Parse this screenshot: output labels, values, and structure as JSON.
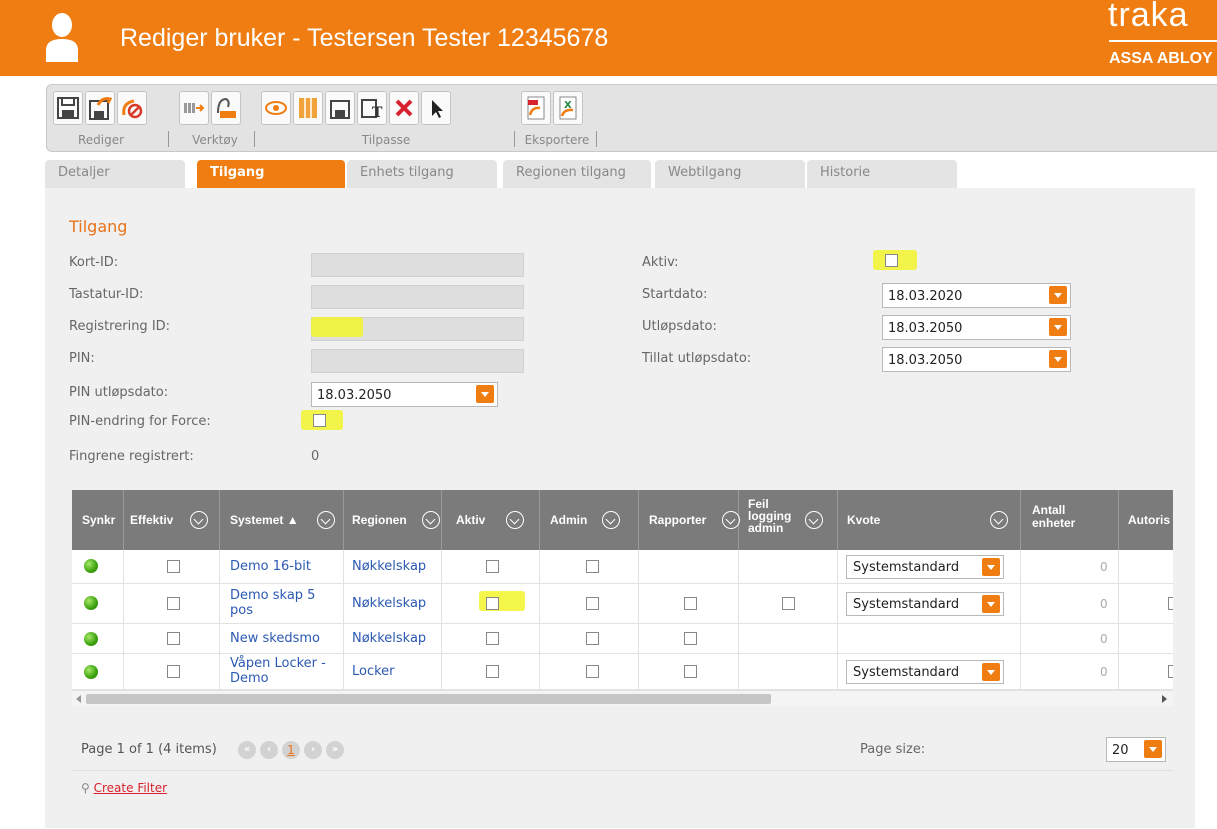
{
  "header": {
    "title": "Rediger bruker - Testersen Tester 12345678",
    "brand_name": "traka",
    "brand_sub": "ASSA ABLOY",
    "accent_color": "#ef7d11"
  },
  "toolbar": {
    "groups": [
      {
        "label": "Rediger",
        "icons": [
          "save-icon",
          "save-and-edit-icon",
          "cancel-icon"
        ]
      },
      {
        "label": "Verktøy",
        "icons": [
          "transfer-icon",
          "user-badge-icon"
        ]
      },
      {
        "label": "Tilpasse",
        "icons": [
          "view-icon",
          "columns-icon",
          "layout-save-icon",
          "text-format-icon",
          "delete-icon",
          "select-cursor-icon"
        ]
      },
      {
        "label": "Eksportere",
        "icons": [
          "export-pdf-icon",
          "export-excel-icon"
        ]
      }
    ]
  },
  "tabs": [
    "Detaljer",
    "Tilgang",
    "Enhets tilgang",
    "Regionen tilgang",
    "Webtilgang",
    "Historie"
  ],
  "active_tab": "Tilgang",
  "form": {
    "section_title": "Tilgang",
    "kort_id_label": "Kort-ID:",
    "tastatur_id_label": "Tastatur-ID:",
    "registrering_id_label": "Registrering ID:",
    "pin_label": "PIN:",
    "pin_utlop_label": "PIN utløpsdato:",
    "pin_utlop_value": "18.03.2050",
    "pin_force_label": "PIN-endring for Force:",
    "fingre_label": "Fingrene registrert:",
    "fingre_value": "0",
    "aktiv_label": "Aktiv:",
    "startdato_label": "Startdato:",
    "startdato_value": "18.03.2020",
    "utlopsdato_label": "Utløpsdato:",
    "utlopsdato_value": "18.03.2050",
    "tillat_label": "Tillat utløpsdato:",
    "tillat_value": "18.03.2050"
  },
  "grid": {
    "columns": [
      "Synkr",
      "Effektiv",
      "Systemet",
      "Regionen",
      "Aktiv",
      "Admin",
      "Rapporter",
      "Feil logging admin",
      "Kvote",
      "Antall enheter",
      "Autoris"
    ],
    "rows": [
      {
        "system": "Demo 16-bit",
        "region": "Nøkkelskap",
        "kvote": "Systemstandard",
        "antall": "0"
      },
      {
        "system": "Demo skap 5 pos",
        "region": "Nøkkelskap",
        "kvote": "Systemstandard",
        "antall": "0"
      },
      {
        "system": "New skedsmo",
        "region": "Nøkkelskap",
        "kvote": "",
        "antall": "0"
      },
      {
        "system": "Våpen Locker - Demo",
        "region": "Locker",
        "kvote": "Systemstandard",
        "antall": "0"
      }
    ]
  },
  "pager": {
    "summary": "Page 1 of 1 (4 items)",
    "current_page": "1",
    "page_size_label": "Page size:",
    "page_size_value": "20",
    "create_filter": "Create Filter"
  }
}
